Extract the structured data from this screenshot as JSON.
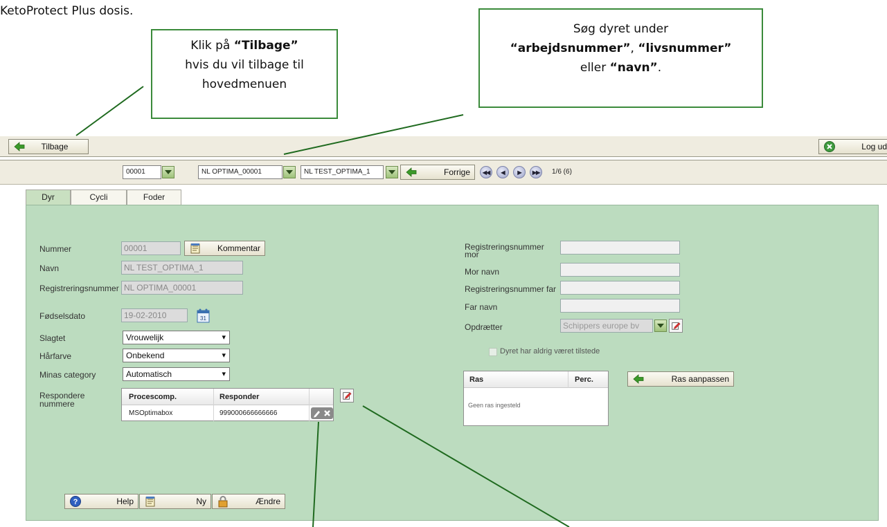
{
  "doc": {
    "intro_text": "KetoProtect Plus dosis."
  },
  "callouts": {
    "left": {
      "line1_pre": "Klik på ",
      "line1_bold": "“Tilbage”",
      "line2": "hvis du vil tilbage til",
      "line3": "hovedmenuen"
    },
    "right": {
      "line1": "Søg dyret under",
      "line2_b1": "“arbejdsnummer”",
      "line2_sep1": ", ",
      "line2_b2": "“livsnummer”",
      "line3_pre": "eller ",
      "line3_b": "“navn”",
      "line3_post": "."
    }
  },
  "toolbar": {
    "back_label": "Tilbage",
    "logout_label": "Log ud"
  },
  "navbar": {
    "work_number": "00001",
    "life_number": "NL OPTIMA_00001",
    "name": "NL TEST_OPTIMA_1",
    "prev_label": "Forrige",
    "nav_first": "◀◀",
    "nav_prev": "◀",
    "nav_next": "▶",
    "nav_last": "▶▶",
    "position": "1/6 (6)"
  },
  "tabs": [
    {
      "label": "Dyr",
      "active": true
    },
    {
      "label": "Cycli",
      "active": false
    },
    {
      "label": "Foder",
      "active": false
    }
  ],
  "form_left": {
    "nummer_label": "Nummer",
    "nummer_value": "00001",
    "comment_label": "Kommentar",
    "navn_label": "Navn",
    "navn_value": "NL TEST_OPTIMA_1",
    "reg_label": "Registreringsnummer",
    "reg_value": "NL OPTIMA_00001",
    "dob_label": "Fødselsdato",
    "dob_value": "19-02-2010",
    "calendar_day": "31",
    "slagtet_label": "Slagtet",
    "slagtet_value": "Vrouwelijk",
    "haarfarve_label": "Hårfarve",
    "haarfarve_value": "Onbekend",
    "minas_label": "Minas category",
    "minas_value": "Automatisch",
    "resp_label_1": "Respondere",
    "resp_label_2": "nummere",
    "resp_table": {
      "col1": "Procescomp.",
      "col2": "Responder",
      "rows": [
        {
          "procescomp": "MSOptimabox",
          "responder": "999000666666666"
        }
      ]
    }
  },
  "form_right": {
    "reg_mor_label_1": "Registreringsnummer",
    "reg_mor_label_2": "mor",
    "mor_navn_label": "Mor navn",
    "reg_far_label": "Registreringsnummer far",
    "far_navn_label": "Far navn",
    "breeder_label": "Opdrætter",
    "breeder_value": "Schippers europe bv",
    "never_present_label": "Dyret har aldrig været tilstede",
    "ras_table": {
      "col1": "Ras",
      "col2": "Perc.",
      "empty_text": "Geen ras ingesteld"
    },
    "ras_button_label": "Ras aanpassen"
  },
  "bottom_buttons": {
    "help_label": "Help",
    "new_label": "Ny",
    "change_label": "Ændre"
  },
  "colors": {
    "panel_bg": "#bcdcbf",
    "toolbar_bg": "#efece0",
    "callout_border": "#3a8a3a",
    "arrow_green": "#3c9a2a"
  }
}
